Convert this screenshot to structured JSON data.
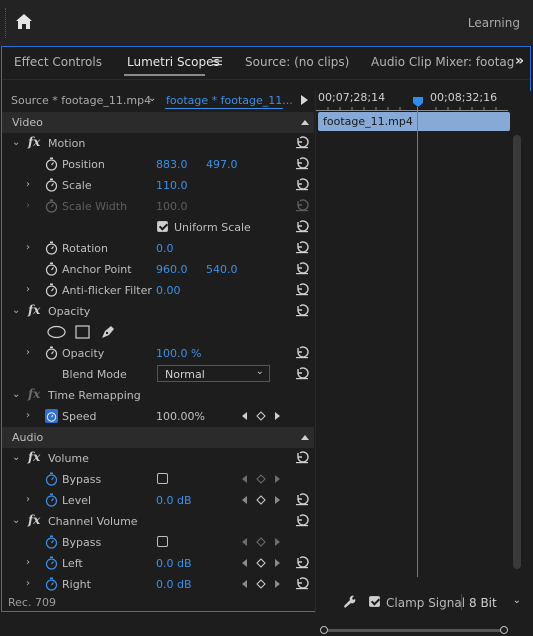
{
  "workspace": {
    "label": "Learning"
  },
  "tabs": [
    {
      "label": "Effect Controls"
    },
    {
      "label": "Lumetri Scopes",
      "active": true
    },
    {
      "label": "Source: (no clips)"
    },
    {
      "label": "Audio Clip Mixer: footag"
    }
  ],
  "source": {
    "label": "Source * footage_11.mp4",
    "clip": "footage * footage_11..."
  },
  "sections": {
    "video": "Video",
    "audio": "Audio"
  },
  "motion": {
    "name": "Motion",
    "position": {
      "label": "Position",
      "x": "883.0",
      "y": "497.0"
    },
    "scale": {
      "label": "Scale",
      "value": "110.0"
    },
    "scale_width": {
      "label": "Scale Width",
      "value": "100.0"
    },
    "uniform_scale": {
      "label": "Uniform Scale",
      "checked": true
    },
    "rotation": {
      "label": "Rotation",
      "value": "0.0"
    },
    "anchor": {
      "label": "Anchor Point",
      "x": "960.0",
      "y": "540.0"
    },
    "antiflicker": {
      "label": "Anti-flicker Filter",
      "value": "0.00"
    }
  },
  "opacity": {
    "name": "Opacity",
    "opacity": {
      "label": "Opacity",
      "value": "100.0 %"
    },
    "blend": {
      "label": "Blend Mode",
      "value": "Normal"
    }
  },
  "time_remap": {
    "name": "Time Remapping",
    "speed": {
      "label": "Speed",
      "value": "100.00%"
    }
  },
  "volume": {
    "name": "Volume",
    "bypass": {
      "label": "Bypass"
    },
    "level": {
      "label": "Level",
      "value": "0.0 dB"
    }
  },
  "channel_volume": {
    "name": "Channel Volume",
    "bypass": {
      "label": "Bypass"
    },
    "left": {
      "label": "Left",
      "value": "0.0 dB"
    },
    "right": {
      "label": "Right",
      "value": "0.0 dB"
    }
  },
  "timeline": {
    "tc_left": "00;07;28;14",
    "tc_right": "00;08;32;16",
    "clip_name": "footage_11.mp4"
  },
  "status": {
    "rec": "Rec. 709",
    "clamp_signal": "Clamp Signal",
    "clamp_checked": true,
    "bit_depth": "8 Bit"
  },
  "colors": {
    "accent_blue": "#3d8fe6",
    "playhead": "#2e8cf0",
    "clip": "#86a9d6",
    "panel_border": "#2e6fd6"
  }
}
